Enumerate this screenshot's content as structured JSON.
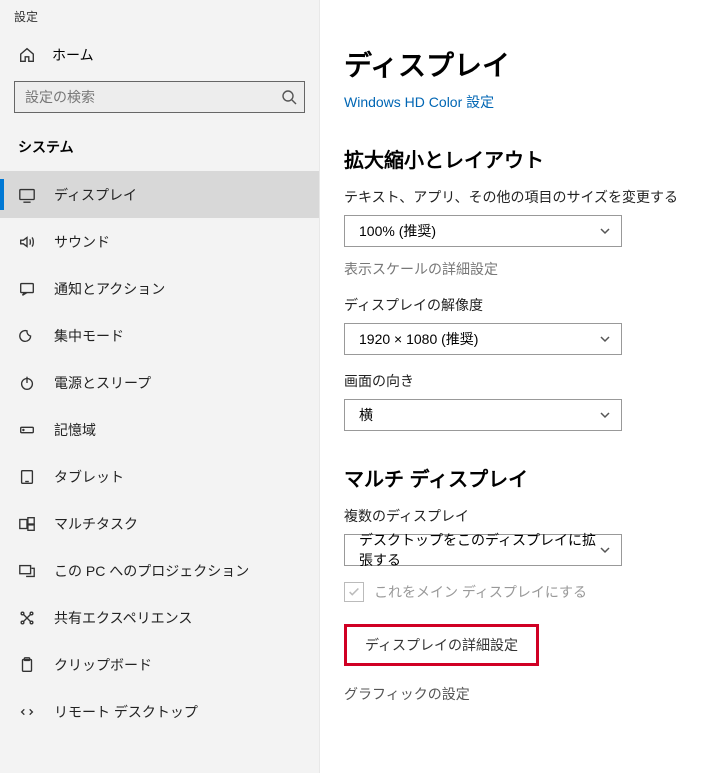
{
  "window": {
    "title": "設定"
  },
  "sidebar": {
    "home_label": "ホーム",
    "search_placeholder": "設定の検索",
    "section": "システム",
    "items": [
      {
        "label": "ディスプレイ",
        "selected": true
      },
      {
        "label": "サウンド"
      },
      {
        "label": "通知とアクション"
      },
      {
        "label": "集中モード"
      },
      {
        "label": "電源とスリープ"
      },
      {
        "label": "記憶域"
      },
      {
        "label": "タブレット"
      },
      {
        "label": "マルチタスク"
      },
      {
        "label": "この PC へのプロジェクション"
      },
      {
        "label": "共有エクスペリエンス"
      },
      {
        "label": "クリップボード"
      },
      {
        "label": "リモート デスクトップ"
      }
    ]
  },
  "main": {
    "title": "ディスプレイ",
    "hdcolor_link": "Windows HD Color 設定",
    "section_scale": {
      "heading": "拡大縮小とレイアウト",
      "scale_label": "テキスト、アプリ、その他の項目のサイズを変更する",
      "scale_value": "100% (推奨)",
      "advanced_scale_link": "表示スケールの詳細設定",
      "resolution_label": "ディスプレイの解像度",
      "resolution_value": "1920 × 1080 (推奨)",
      "orientation_label": "画面の向き",
      "orientation_value": "横"
    },
    "section_multi": {
      "heading": "マルチ ディスプレイ",
      "multi_label": "複数のディスプレイ",
      "multi_value": "デスクトップをこのディスプレイに拡張する",
      "main_display_checkbox": "これをメイン ディスプレイにする",
      "advanced_display_link": "ディスプレイの詳細設定",
      "graphics_link": "グラフィックの設定"
    }
  }
}
